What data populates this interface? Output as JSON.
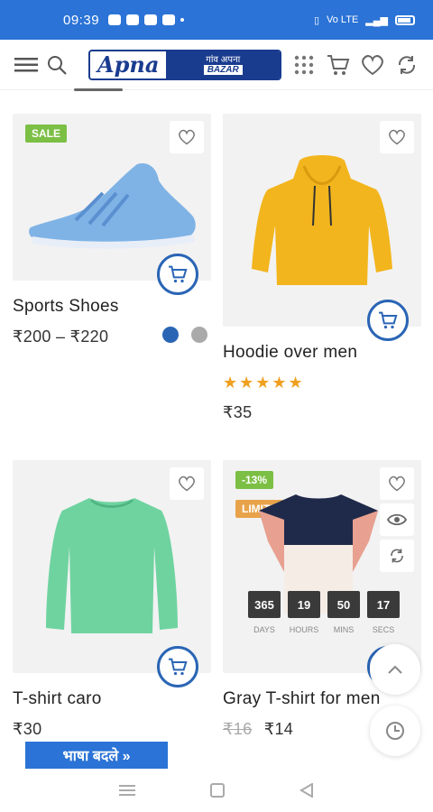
{
  "status_bar": {
    "time": "09:39",
    "signal_text": "Vo LTE"
  },
  "header": {
    "logo_main": "Apna",
    "logo_tag_top": "गांव अपना",
    "logo_tag_sub": "BAZAR"
  },
  "products": [
    {
      "title": "Sports Shoes",
      "price": "₹200 – ₹220",
      "badge": "SALE",
      "swatches": [
        "#2a65b5",
        "#aaaaaa"
      ]
    },
    {
      "title": "Hoodie over men",
      "price": "₹35",
      "rating": 5,
      "stars": "★★★★★"
    },
    {
      "title": "T-shirt caro",
      "price": "₹30"
    },
    {
      "title": "Gray T-shirt for men",
      "old_price": "₹16",
      "price": "₹14",
      "badge": "-13%",
      "badge2": "LIMITED",
      "countdown": [
        {
          "value": "365",
          "label": "DAYS"
        },
        {
          "value": "19",
          "label": "HOURS"
        },
        {
          "value": "50",
          "label": "MINS"
        },
        {
          "value": "17",
          "label": "SECS"
        }
      ]
    }
  ],
  "language_button": "भाषा बदले »",
  "colors": {
    "accent": "#2b73d6",
    "cart_ring": "#2a65b5",
    "sale_green": "#7cbf45",
    "limited_orange": "#e8a34a",
    "star": "#f0a020"
  }
}
